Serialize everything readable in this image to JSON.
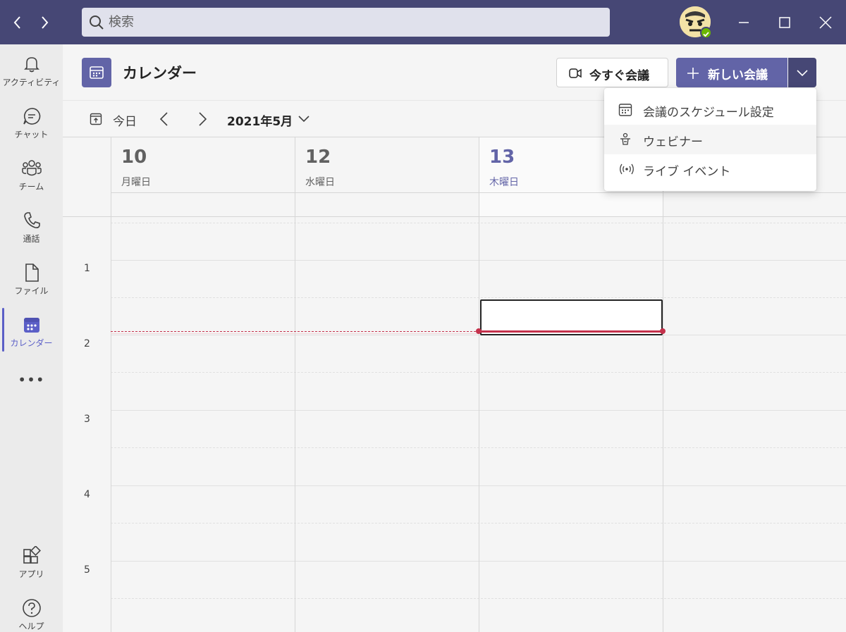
{
  "titlebar": {
    "back_icon": "chevron-left-icon",
    "forward_icon": "chevron-right-icon",
    "search_placeholder": "検索",
    "search_icon": "search-icon",
    "window_controls": [
      "minimize-icon",
      "maximize-icon",
      "close-icon"
    ],
    "presence_status": "available"
  },
  "rail": {
    "items": [
      {
        "label": "アクティビティ",
        "icon": "bell-icon"
      },
      {
        "label": "チャット",
        "icon": "chat-icon"
      },
      {
        "label": "チーム",
        "icon": "teams-icon"
      },
      {
        "label": "通話",
        "icon": "phone-icon"
      },
      {
        "label": "ファイル",
        "icon": "file-icon"
      },
      {
        "label": "カレンダー",
        "icon": "calendar-icon",
        "active": true
      }
    ],
    "more": "•••",
    "bottom_items": [
      {
        "label": "アプリ",
        "icon": "apps-icon"
      },
      {
        "label": "ヘルプ",
        "icon": "help-icon"
      }
    ]
  },
  "header": {
    "title": "カレンダー",
    "meet_now_label": "今すぐ会議",
    "new_meeting_label": "新しい会議"
  },
  "toolbar": {
    "today_label": "今日",
    "month_label": "2021年5月"
  },
  "days": [
    {
      "num": "10",
      "name": "月曜日",
      "today": false
    },
    {
      "num": "12",
      "name": "水曜日",
      "today": false
    },
    {
      "num": "13",
      "name": "木曜日",
      "today": true
    }
  ],
  "hours": [
    "1",
    "2",
    "3",
    "4",
    "5"
  ],
  "menu": {
    "items": [
      {
        "label": "会議のスケジュール設定",
        "icon": "calendar-schedule-icon"
      },
      {
        "label": "ウェビナー",
        "icon": "webinar-icon"
      },
      {
        "label": "ライブ イベント",
        "icon": "live-event-icon"
      }
    ]
  },
  "colors": {
    "titlebar": "#464775",
    "accent": "#6264a7",
    "now_line": "#c4314b",
    "presence": "#6bb700"
  }
}
